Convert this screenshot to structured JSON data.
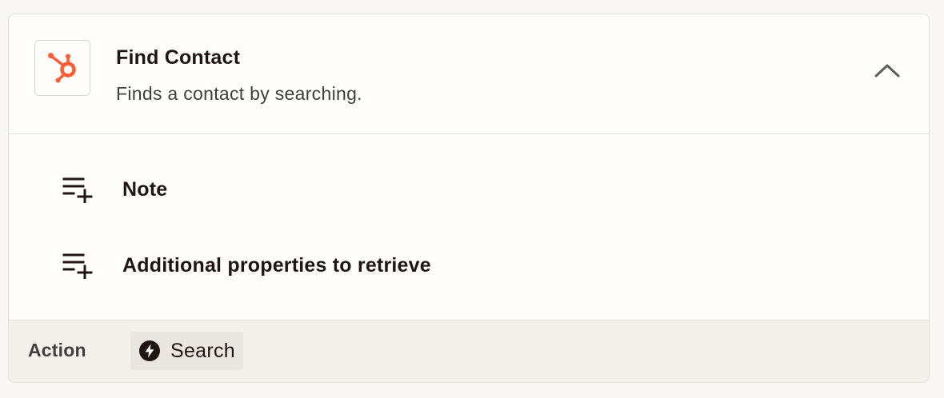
{
  "step": {
    "app_icon": "hubspot-logo",
    "title": "Find Contact",
    "description": "Finds a contact by searching.",
    "toggle_icon": "chevron-up-icon"
  },
  "fields": [
    {
      "label": "Note",
      "icon": "playlist-add-icon"
    },
    {
      "label": "Additional properties to retrieve",
      "icon": "playlist-add-icon"
    }
  ],
  "footer": {
    "label": "Action",
    "chip_label": "Search",
    "chip_icon": "bolt-icon"
  },
  "colors": {
    "hubspot_orange": "#ff5c35",
    "text_primary": "#201515",
    "text_secondary": "#403f3e",
    "border": "#e3e1da",
    "footer_bg": "#f2f0eb"
  }
}
